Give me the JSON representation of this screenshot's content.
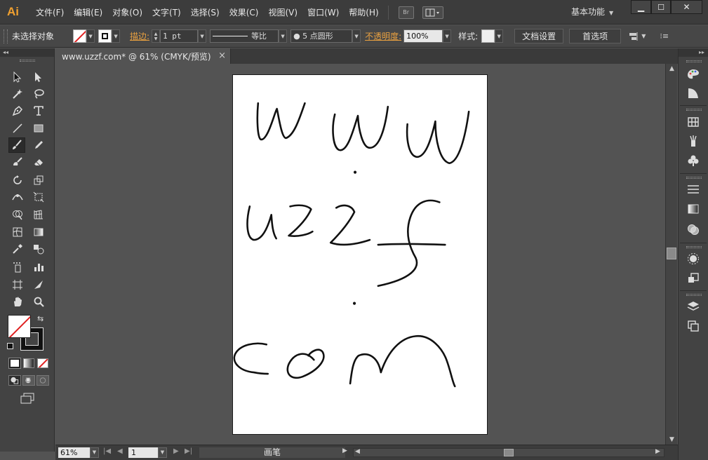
{
  "app": {
    "logo": "Ai"
  },
  "menu": {
    "items": [
      "文件(F)",
      "编辑(E)",
      "对象(O)",
      "文字(T)",
      "选择(S)",
      "效果(C)",
      "视图(V)",
      "窗口(W)",
      "帮助(H)"
    ],
    "bridge_label": "Br",
    "workspace": "基本功能"
  },
  "control": {
    "selection": "未选择对象",
    "stroke_label": "描边:",
    "stroke_weight": "1 pt",
    "profile_label": "等比",
    "brush_label": "5 点圆形",
    "opacity_label": "不透明度:",
    "opacity_value": "100%",
    "style_label": "样式:",
    "doc_setup": "文档设置",
    "preferences": "首选项"
  },
  "document": {
    "tab_title": "www.uzzf.com* @ 61% (CMYK/预览)"
  },
  "status": {
    "zoom": "61%",
    "page": "1",
    "current_tool": "画笔"
  },
  "colors": {
    "accent": "#f0a030",
    "stroke_none": "#e02020"
  }
}
